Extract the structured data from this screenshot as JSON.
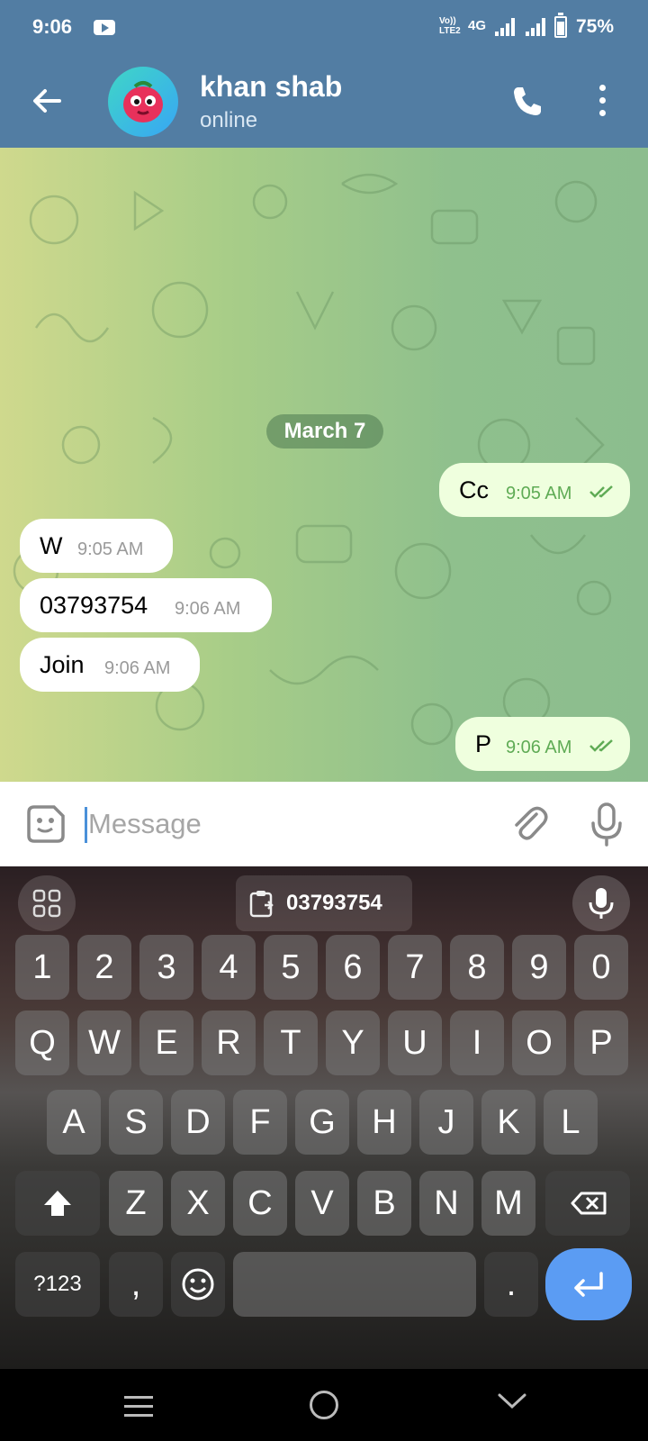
{
  "status_bar": {
    "time": "9:06",
    "volte_line1": "Vo))",
    "volte_line2": "LTE2",
    "network": "4G",
    "battery": "75%",
    "battery_level": 0.75
  },
  "header": {
    "title": "khan shab",
    "subtitle": "online"
  },
  "chat": {
    "date_label": "March 7",
    "messages": [
      {
        "text": "Cc",
        "time": "9:05 AM",
        "direction": "out",
        "status": "read"
      },
      {
        "text": "W",
        "time": "9:05 AM",
        "direction": "in"
      },
      {
        "text": "03793754",
        "time": "9:06 AM",
        "direction": "in"
      },
      {
        "text": "Join",
        "time": "9:06 AM",
        "direction": "in"
      },
      {
        "text": "P",
        "time": "9:06 AM",
        "direction": "out",
        "status": "read"
      }
    ]
  },
  "composer": {
    "placeholder": "Message"
  },
  "keyboard": {
    "clipboard": "03793754",
    "number_row": [
      "1",
      "2",
      "3",
      "4",
      "5",
      "6",
      "7",
      "8",
      "9",
      "0"
    ],
    "row1": [
      "Q",
      "W",
      "E",
      "R",
      "T",
      "Y",
      "U",
      "I",
      "O",
      "P"
    ],
    "row2": [
      "A",
      "S",
      "D",
      "F",
      "G",
      "H",
      "J",
      "K",
      "L"
    ],
    "row3": [
      "Z",
      "X",
      "C",
      "V",
      "B",
      "N",
      "M"
    ],
    "symbols_key": "?123",
    "comma_key": ",",
    "period_key": "."
  },
  "colors": {
    "header": "#527DA3",
    "outgoing_bubble": "#efffde",
    "incoming_bubble": "#ffffff",
    "enter_key": "#5b9cf3"
  }
}
